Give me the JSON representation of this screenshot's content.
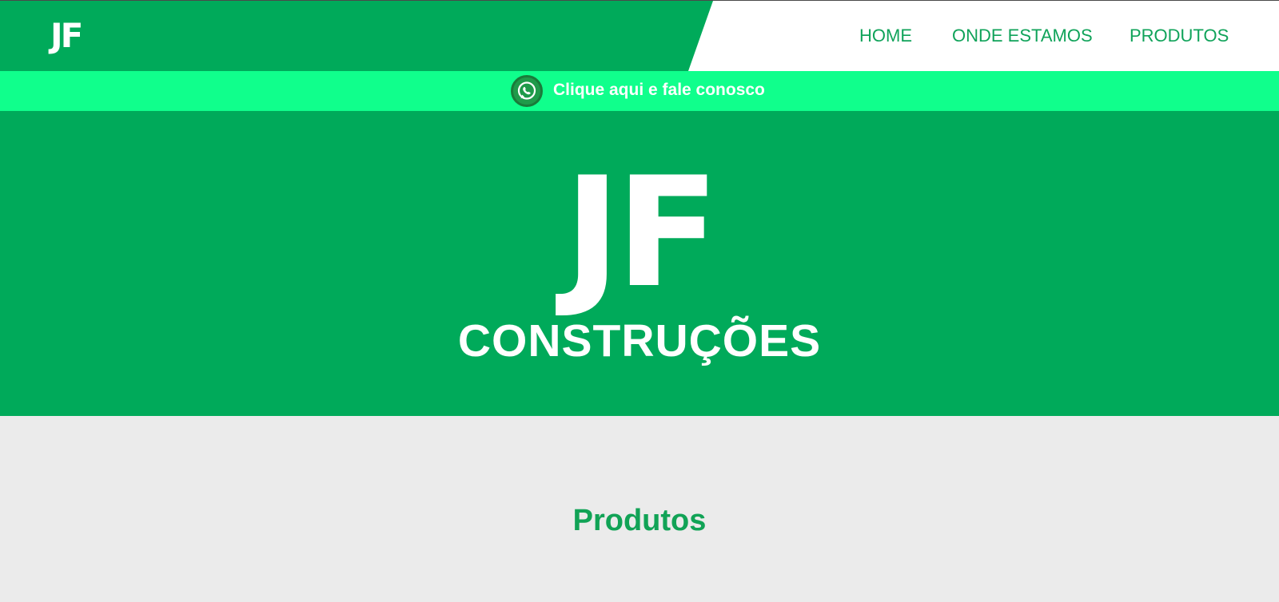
{
  "header": {
    "logo": "JF",
    "nav": [
      {
        "label": "HOME"
      },
      {
        "label": "ONDE ESTAMOS"
      },
      {
        "label": "PRODUTOS"
      }
    ]
  },
  "whatsapp_bar": {
    "icon": "whatsapp-icon",
    "text": "Clique aqui e fale conosco"
  },
  "hero": {
    "title": "JF",
    "subtitle": "CONSTRUÇÕES"
  },
  "products": {
    "title": "Produtos"
  },
  "colors": {
    "brand_green": "#00aa5a",
    "whatsapp_bar": "#10ff8c",
    "nav_text": "#10a35a",
    "section_bg": "#ebebeb"
  }
}
